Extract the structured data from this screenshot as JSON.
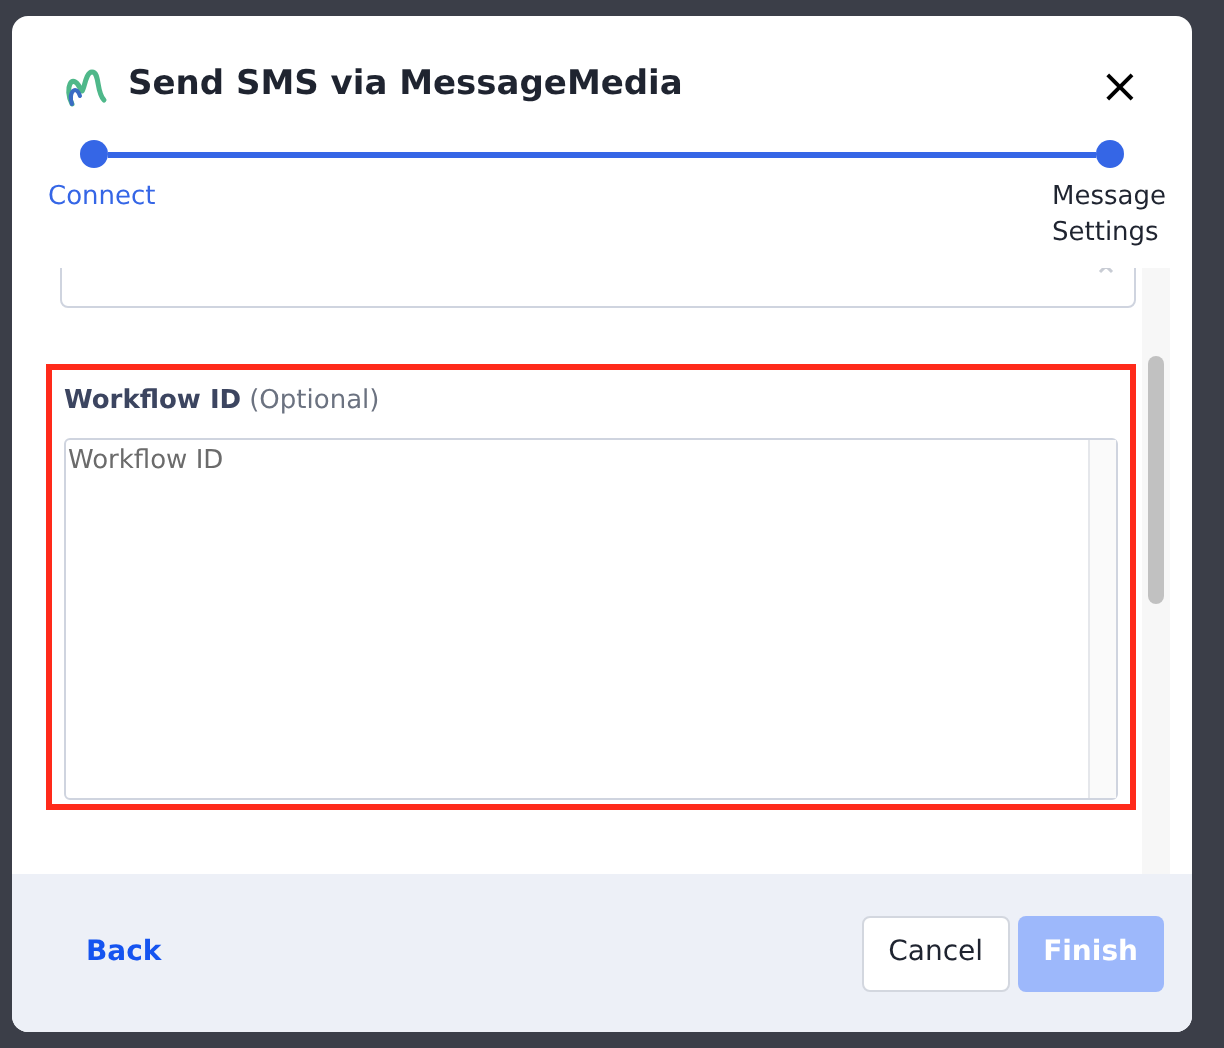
{
  "dialog": {
    "title": "Send SMS via MessageMedia",
    "close": "×"
  },
  "steps": [
    {
      "label": "Connect",
      "completed": true
    },
    {
      "label": "Message Settings",
      "completed": false
    }
  ],
  "workflow_field": {
    "label": "Workflow ID",
    "hint": "(Optional)",
    "placeholder": "Workflow ID",
    "highlighted": true
  },
  "footer": {
    "back": "Back",
    "cancel": "Cancel",
    "finish": "Finish",
    "finish_disabled": true
  }
}
